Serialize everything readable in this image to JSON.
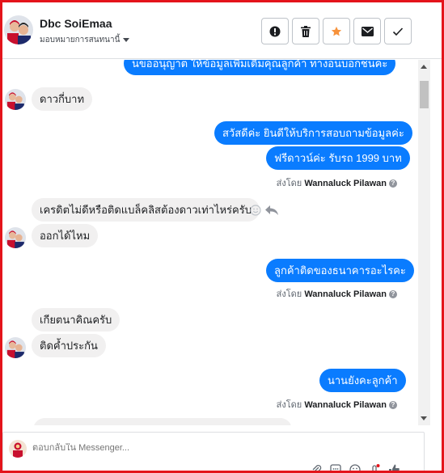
{
  "header": {
    "name": "Dbc SoiEmaa",
    "assigned": "มอบหมายการสนทนานี้",
    "actions": [
      {
        "icon": "alert-icon",
        "label": "report"
      },
      {
        "icon": "trash-icon",
        "label": "delete"
      },
      {
        "icon": "star-icon",
        "label": "star"
      },
      {
        "icon": "mail-icon",
        "label": "mark-unread"
      },
      {
        "icon": "check-icon",
        "label": "done"
      }
    ]
  },
  "messages": [
    {
      "dir": "out",
      "text": "นขออนุญาต ให้ข้อมูลเพิ่มเติมคุณลูกค้า ทางอนบอกชนคะ"
    },
    {
      "dir": "in",
      "text": "ดาวกี่บาท"
    },
    {
      "dir": "out",
      "text": "สวัสดีค่ะ ยินดีให้บริการสอบถามข้อมูลค่ะ"
    },
    {
      "dir": "out",
      "text": "ฟรีดาวน์ค่ะ รับรถ 1999 บาท"
    },
    {
      "dir": "in",
      "text": "เครดิตไม่ดีหรือติดแบล็คลิสต้องดาวเท่าไหร่ครับ"
    },
    {
      "dir": "in",
      "text": "ออกได้ไหม"
    },
    {
      "dir": "out",
      "text": "ลูกค้าติดของธนาคารอะไรคะ"
    },
    {
      "dir": "in",
      "text": "เกียตนาคิณครับ"
    },
    {
      "dir": "in",
      "text": "ติดค้ำประกัน"
    },
    {
      "dir": "out",
      "text": "นานยังคะลูกค้า"
    }
  ],
  "sent_by": {
    "prefix": "ส่งโดย",
    "name": "Wannaluck Pilawan",
    "help": "?"
  },
  "composer": {
    "placeholder": "ตอบกลับใน Messenger..."
  },
  "colors": {
    "outgoing": "#0a7cff",
    "incoming": "#f1f0f0",
    "star": "#f7923b",
    "frame": "#e4141b"
  }
}
